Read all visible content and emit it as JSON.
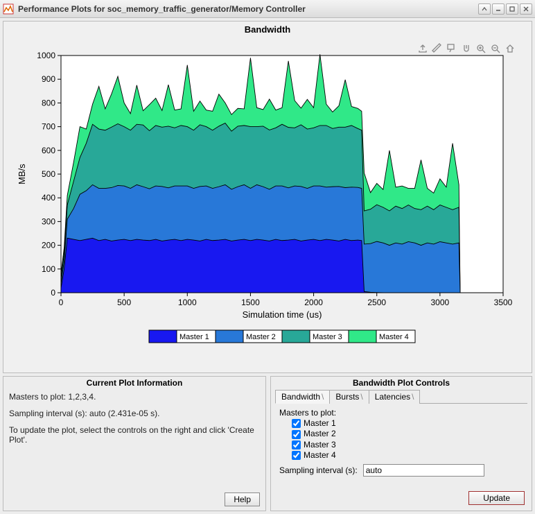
{
  "window": {
    "title": "Performance Plots for soc_memory_traffic_generator/Memory Controller"
  },
  "chart_data": {
    "type": "area",
    "title": "Bandwidth",
    "xlabel": "Simulation time (us)",
    "ylabel": "MB/s",
    "xlim": [
      0,
      3500
    ],
    "ylim": [
      0,
      1000
    ],
    "xticks": [
      0,
      500,
      1000,
      1500,
      2000,
      2500,
      3000,
      3500
    ],
    "yticks": [
      0,
      100,
      200,
      300,
      400,
      500,
      600,
      700,
      800,
      900,
      1000
    ],
    "legend": [
      "Master 1",
      "Master 2",
      "Master 3",
      "Master 4"
    ],
    "colors": [
      "#1818f0",
      "#2878d8",
      "#28a898",
      "#30e888"
    ],
    "x": [
      0,
      25,
      50,
      100,
      150,
      200,
      250,
      300,
      350,
      400,
      450,
      500,
      550,
      600,
      650,
      700,
      750,
      800,
      850,
      900,
      950,
      1000,
      1050,
      1100,
      1150,
      1200,
      1250,
      1300,
      1350,
      1400,
      1450,
      1500,
      1550,
      1600,
      1650,
      1700,
      1750,
      1800,
      1850,
      1900,
      1950,
      2000,
      2050,
      2100,
      2150,
      2200,
      2250,
      2300,
      2350,
      2380,
      2400,
      2450,
      2500,
      2550,
      2600,
      2650,
      2700,
      2750,
      2800,
      2850,
      2900,
      2950,
      3000,
      3050,
      3100,
      3150,
      3160
    ],
    "series": [
      {
        "name": "Master 1",
        "values": [
          20,
          100,
          230,
          225,
          220,
          225,
          230,
          220,
          225,
          218,
          222,
          225,
          220,
          225,
          222,
          220,
          225,
          218,
          222,
          225,
          220,
          225,
          222,
          218,
          225,
          220,
          222,
          225,
          218,
          222,
          225,
          220,
          225,
          222,
          218,
          225,
          220,
          222,
          225,
          218,
          222,
          225,
          220,
          225,
          222,
          218,
          225,
          220,
          222,
          220,
          5,
          2,
          1,
          0,
          0,
          0,
          0,
          0,
          0,
          0,
          0,
          0,
          0,
          0,
          0,
          0,
          0
        ]
      },
      {
        "name": "Master 2",
        "values": [
          20,
          35,
          80,
          130,
          195,
          205,
          225,
          220,
          215,
          225,
          230,
          225,
          220,
          230,
          225,
          218,
          225,
          230,
          220,
          225,
          230,
          225,
          218,
          230,
          225,
          220,
          225,
          230,
          218,
          225,
          230,
          220,
          230,
          225,
          218,
          225,
          230,
          220,
          225,
          230,
          218,
          225,
          230,
          220,
          225,
          230,
          218,
          225,
          222,
          220,
          200,
          205,
          215,
          210,
          200,
          210,
          205,
          215,
          210,
          200,
          210,
          205,
          215,
          210,
          205,
          210,
          0
        ]
      },
      {
        "name": "Master 3",
        "values": [
          20,
          30,
          60,
          115,
          155,
          200,
          255,
          250,
          245,
          255,
          260,
          250,
          245,
          255,
          260,
          245,
          255,
          250,
          260,
          245,
          255,
          250,
          245,
          260,
          250,
          245,
          255,
          260,
          245,
          255,
          250,
          260,
          245,
          255,
          250,
          245,
          260,
          255,
          245,
          260,
          250,
          245,
          255,
          260,
          245,
          250,
          255,
          260,
          248,
          245,
          140,
          145,
          155,
          150,
          145,
          155,
          150,
          155,
          145,
          150,
          155,
          145,
          155,
          150,
          145,
          150,
          0
        ]
      },
      {
        "name": "Master 4",
        "values": [
          20,
          25,
          40,
          80,
          130,
          60,
          85,
          180,
          90,
          140,
          200,
          100,
          70,
          165,
          60,
          110,
          115,
          70,
          175,
          75,
          70,
          260,
          80,
          100,
          70,
          80,
          135,
          85,
          70,
          75,
          70,
          290,
          80,
          70,
          130,
          75,
          70,
          280,
          115,
          70,
          125,
          85,
          300,
          90,
          70,
          90,
          200,
          80,
          85,
          80,
          160,
          70,
          90,
          75,
          255,
          80,
          95,
          70,
          85,
          210,
          75,
          70,
          110,
          85,
          280,
          95,
          0
        ]
      }
    ]
  },
  "info": {
    "header": "Current Plot Information",
    "line1": "Masters to plot: 1,2,3,4.",
    "line2": "Sampling interval (s): auto (2.431e-05 s).",
    "line3": "To update the plot, select the controls on the right and click 'Create Plot'.",
    "help_label": "Help"
  },
  "controls": {
    "header": "Bandwidth Plot Controls",
    "tabs": [
      "Bandwidth",
      "Bursts",
      "Latencies"
    ],
    "active_tab": "Bandwidth",
    "masters_label": "Masters to plot:",
    "masters": [
      {
        "label": "Master 1",
        "checked": true
      },
      {
        "label": "Master 2",
        "checked": true
      },
      {
        "label": "Master 3",
        "checked": true
      },
      {
        "label": "Master 4",
        "checked": true
      }
    ],
    "sampling_label": "Sampling interval (s):",
    "sampling_value": "auto",
    "update_label": "Update"
  }
}
